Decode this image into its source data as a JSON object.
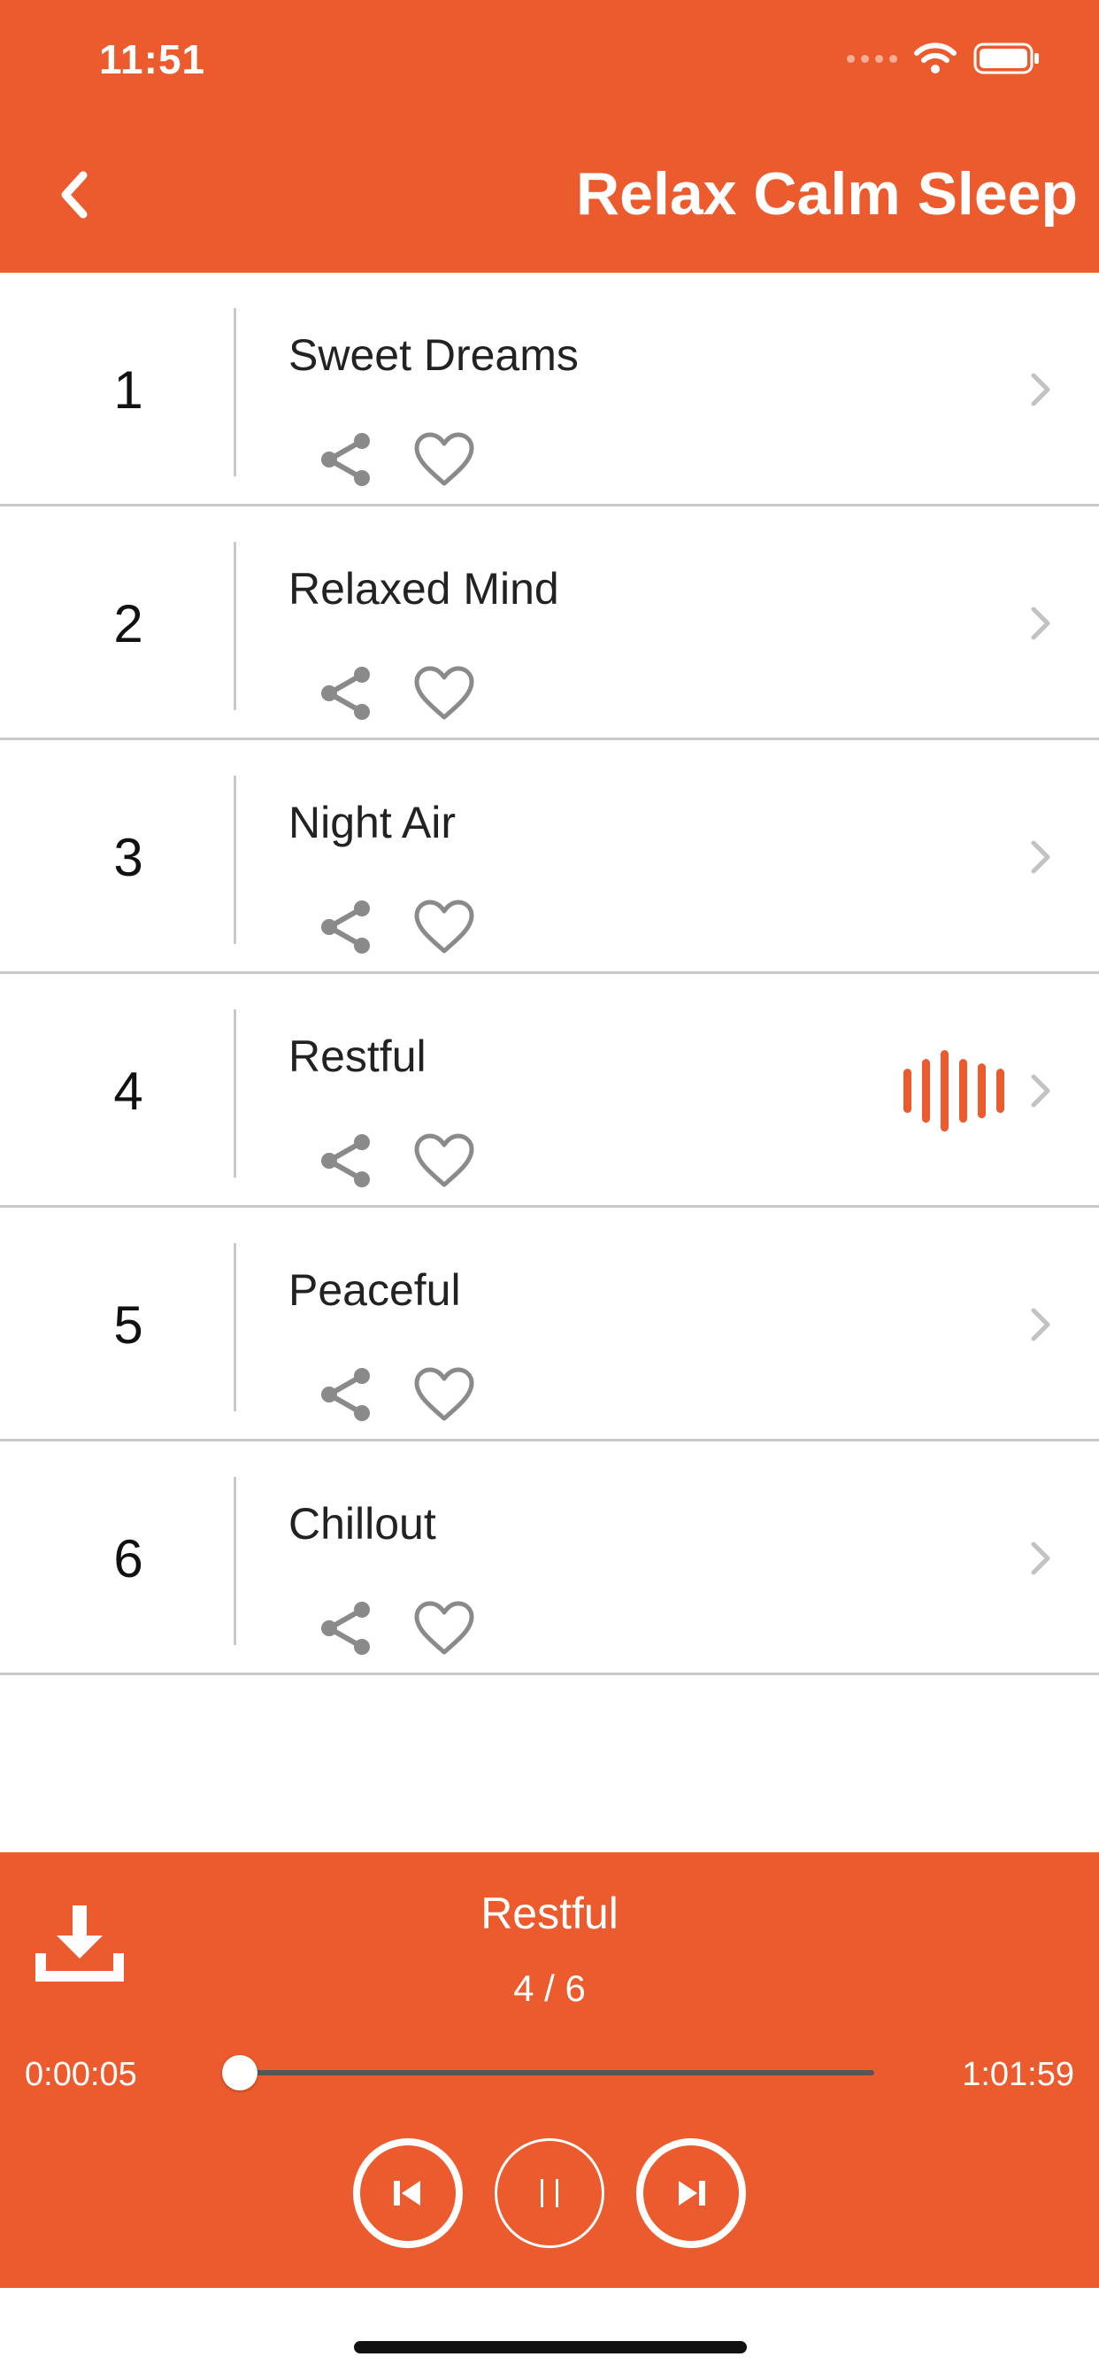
{
  "status_bar": {
    "time": "11:51"
  },
  "header": {
    "title": "Relax Calm Sleep",
    "back_icon": "chevron-left-icon"
  },
  "colors": {
    "accent": "#EC5B2D",
    "icon_gray": "#8a8a8a",
    "divider": "#c9c9c9"
  },
  "tracks": [
    {
      "number": "1",
      "title": "Sweet Dreams",
      "playing": false
    },
    {
      "number": "2",
      "title": "Relaxed Mind",
      "playing": false
    },
    {
      "number": "3",
      "title": "Night Air",
      "playing": false
    },
    {
      "number": "4",
      "title": "Restful",
      "playing": true
    },
    {
      "number": "5",
      "title": "Peaceful",
      "playing": false
    },
    {
      "number": "6",
      "title": "Chillout",
      "playing": false
    }
  ],
  "player": {
    "title": "Restful",
    "counter": "4 / 6",
    "elapsed": "0:00:05",
    "total": "1:01:59",
    "progress": 0.0014,
    "state": "playing"
  }
}
